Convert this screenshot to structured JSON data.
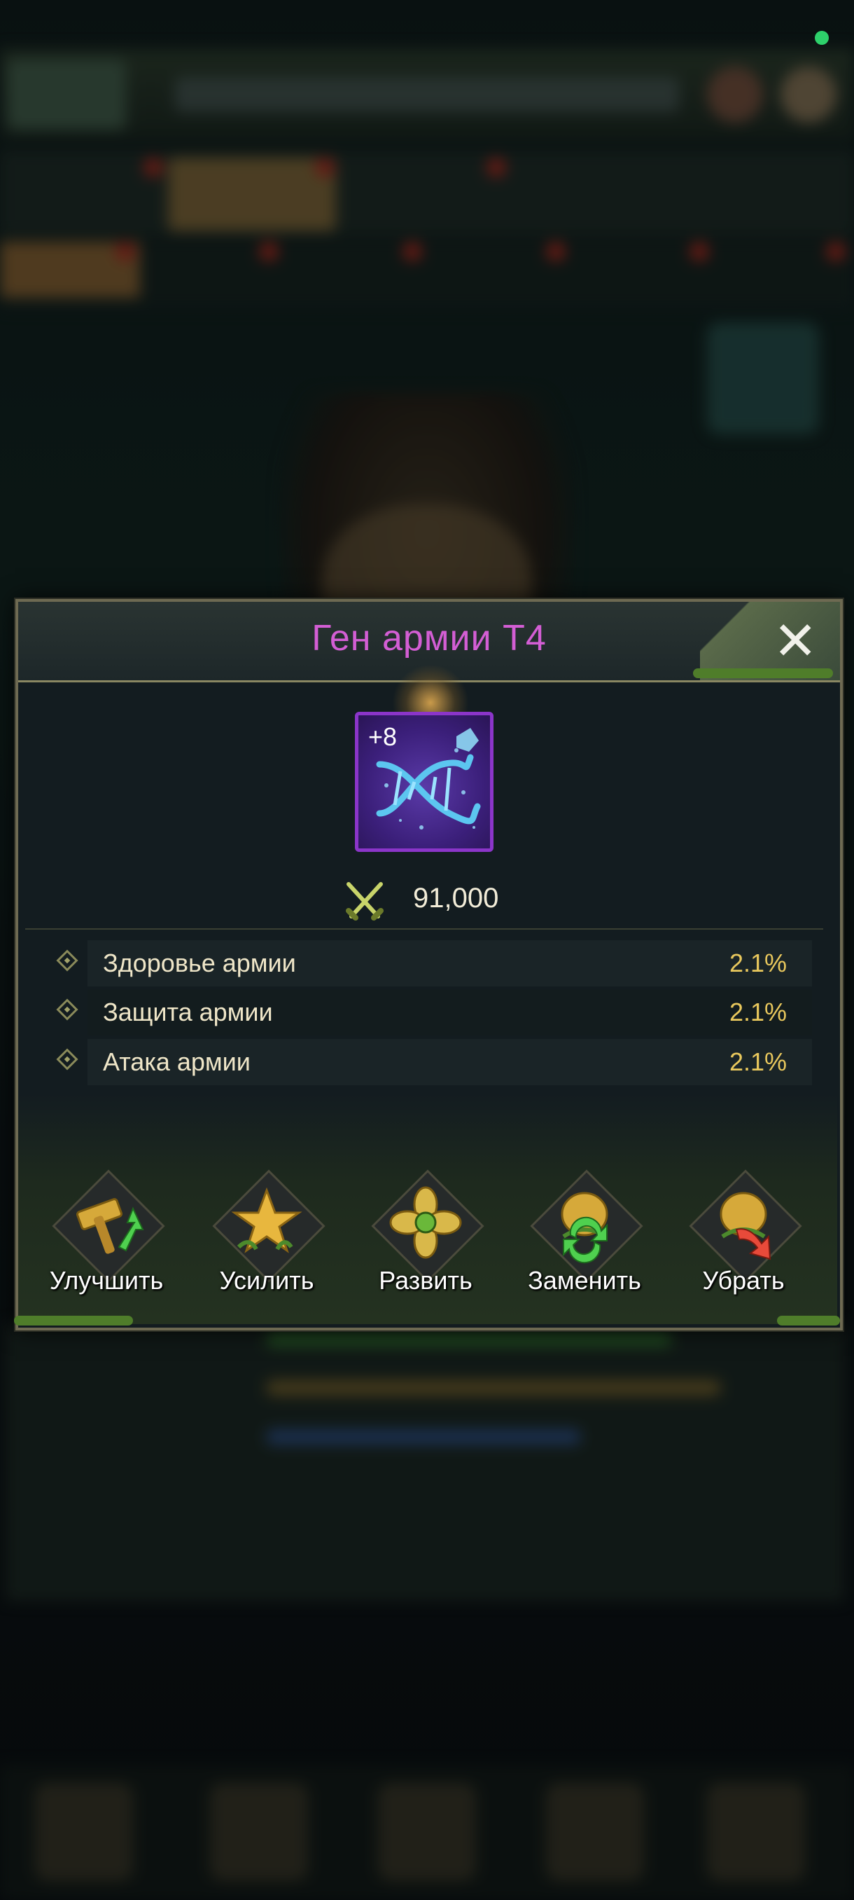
{
  "modal": {
    "title": "Ген армии T4",
    "close_icon": "close-x-icon"
  },
  "item": {
    "name_icon": "dna-gene-icon",
    "level": "+8",
    "rarity_color": "#8b35c9"
  },
  "power": {
    "icon": "crossed-swords-icon",
    "value": "91,000"
  },
  "stats": [
    {
      "label": "Здоровье армии",
      "value": "2.1%"
    },
    {
      "label": "Защита армии",
      "value": "2.1%"
    },
    {
      "label": "Атака армии",
      "value": "2.1%"
    }
  ],
  "actions": [
    {
      "label": "Улучшить",
      "icon": "hammer-upgrade-icon"
    },
    {
      "label": "Усилить",
      "icon": "star-icon"
    },
    {
      "label": "Развить",
      "icon": "flower-evolve-icon"
    },
    {
      "label": "Заменить",
      "icon": "swap-icon"
    },
    {
      "label": "Убрать",
      "icon": "remove-icon"
    }
  ],
  "colors": {
    "title": "#d35ed4",
    "stat_value": "#e9c85d",
    "status_dot": "#2ed16b"
  }
}
